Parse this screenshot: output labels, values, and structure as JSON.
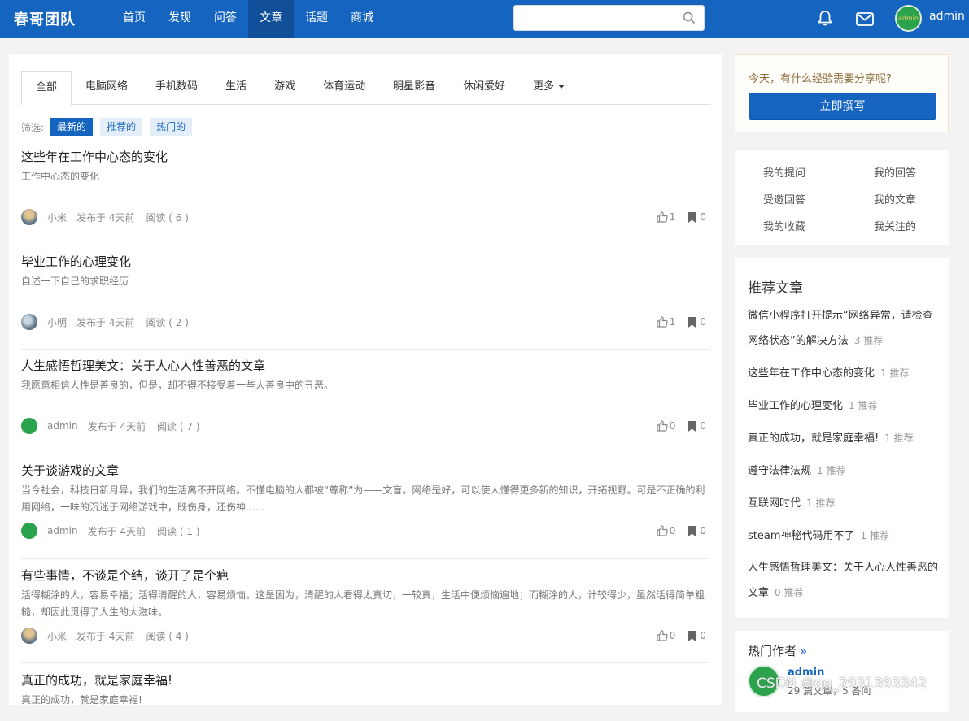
{
  "header": {
    "brand": "春哥团队",
    "nav": [
      {
        "label": "首页"
      },
      {
        "label": "发现"
      },
      {
        "label": "问答"
      },
      {
        "label": "文章",
        "active": true
      },
      {
        "label": "话题"
      },
      {
        "label": "商城"
      }
    ],
    "search_value": "",
    "search_placeholder": "",
    "user": "admin",
    "avatar_text": "admin"
  },
  "tabs": [
    {
      "label": "全部",
      "active": true
    },
    {
      "label": "电脑网络"
    },
    {
      "label": "手机数码"
    },
    {
      "label": "生活"
    },
    {
      "label": "游戏"
    },
    {
      "label": "体育运动"
    },
    {
      "label": "明星影音"
    },
    {
      "label": "休闲爱好"
    },
    {
      "label": "更多"
    }
  ],
  "filter": {
    "label": "筛选:",
    "options": [
      {
        "label": "最新的",
        "active": true
      },
      {
        "label": "推荐的"
      },
      {
        "label": "热门的"
      }
    ]
  },
  "articles": [
    {
      "title": "这些年在工作中心态的变化",
      "summary": "工作中心态的变化",
      "author": "小米",
      "avatar": "xiaomi",
      "time": "发布于 4天前",
      "reads": "阅读 ( 6 )",
      "likes": "1",
      "bookmarks": "0"
    },
    {
      "title": "毕业工作的心理变化",
      "summary": "自述一下自己的求职经历",
      "author": "小明",
      "avatar": "xiaoming",
      "time": "发布于 4天前",
      "reads": "阅读 ( 2 )",
      "likes": "1",
      "bookmarks": "0"
    },
    {
      "title": "人生感悟哲理美文：关于人心人性善恶的文章",
      "summary": "我愿意相信人性是善良的，但是，却不得不接受着一些人善良中的丑恶。",
      "author": "admin",
      "avatar": "admin",
      "time": "发布于 4天前",
      "reads": "阅读 ( 7 )",
      "likes": "0",
      "bookmarks": "0"
    },
    {
      "title": "关于谈游戏的文章",
      "summary": "当今社会，科技日新月异，我们的生活离不开网络。不懂电脑的人都被“尊称”为——文盲。网络是好，可以使人懂得更多新的知识，开拓视野。可是不正确的利用网络，一味的沉迷于网络游戏中，既伤身，还伤神……",
      "author": "admin",
      "avatar": "admin",
      "time": "发布于 4天前",
      "reads": "阅读 ( 1 )",
      "likes": "0",
      "bookmarks": "0"
    },
    {
      "title": "有些事情，不谈是个结，谈开了是个疤",
      "summary": "活得糊涂的人，容易幸福；活得清醒的人，容易烦恼。这是因为，清醒的人看得太真切，一较真，生活中便烦恼遍地；而糊涂的人，计较得少，虽然活得简单粗糙，却因此觅得了人生的大滋味。",
      "author": "小米",
      "avatar": "xiaomi",
      "time": "发布于 4天前",
      "reads": "阅读 ( 4 )",
      "likes": "0",
      "bookmarks": "0"
    },
    {
      "title": "真正的成功，就是家庭幸福!",
      "summary": "真正的成功，就是家庭幸福!"
    }
  ],
  "sidebar": {
    "share_text": "今天，有什么经验需要分享呢?",
    "write_button": "立即撰写",
    "quick_links": [
      "我的提问",
      "我的回答",
      "受邀回答",
      "我的文章",
      "我的收藏",
      "我关注的"
    ],
    "recommended_title": "推荐文章",
    "recommended": [
      {
        "title": "微信小程序打开提示“网络异常，请检查网络状态”的解决方法",
        "count": "3 推荐"
      },
      {
        "title": "这些年在工作中心态的变化",
        "count": "1 推荐"
      },
      {
        "title": "毕业工作的心理变化",
        "count": "1 推荐"
      },
      {
        "title": "真正的成功，就是家庭幸福!",
        "count": "1 推荐"
      },
      {
        "title": "遵守法律法规",
        "count": "1 推荐"
      },
      {
        "title": "互联网时代",
        "count": "1 推荐"
      },
      {
        "title": "steam神秘代码用不了",
        "count": "1 推荐"
      },
      {
        "title": "人生感悟哲理美文：关于人心人性善恶的文章",
        "count": "0 推荐"
      }
    ],
    "hot_authors_title": "热门作者",
    "hot_more": "»",
    "hot_author": {
      "name": "admin",
      "stats": "29 篇文章，5 答问"
    }
  },
  "watermark": "CSDN @qq_2931393342",
  "colors": {
    "primary": "#1565c0",
    "nav_active": "#114f98",
    "avatar_green": "#2ba24c"
  }
}
